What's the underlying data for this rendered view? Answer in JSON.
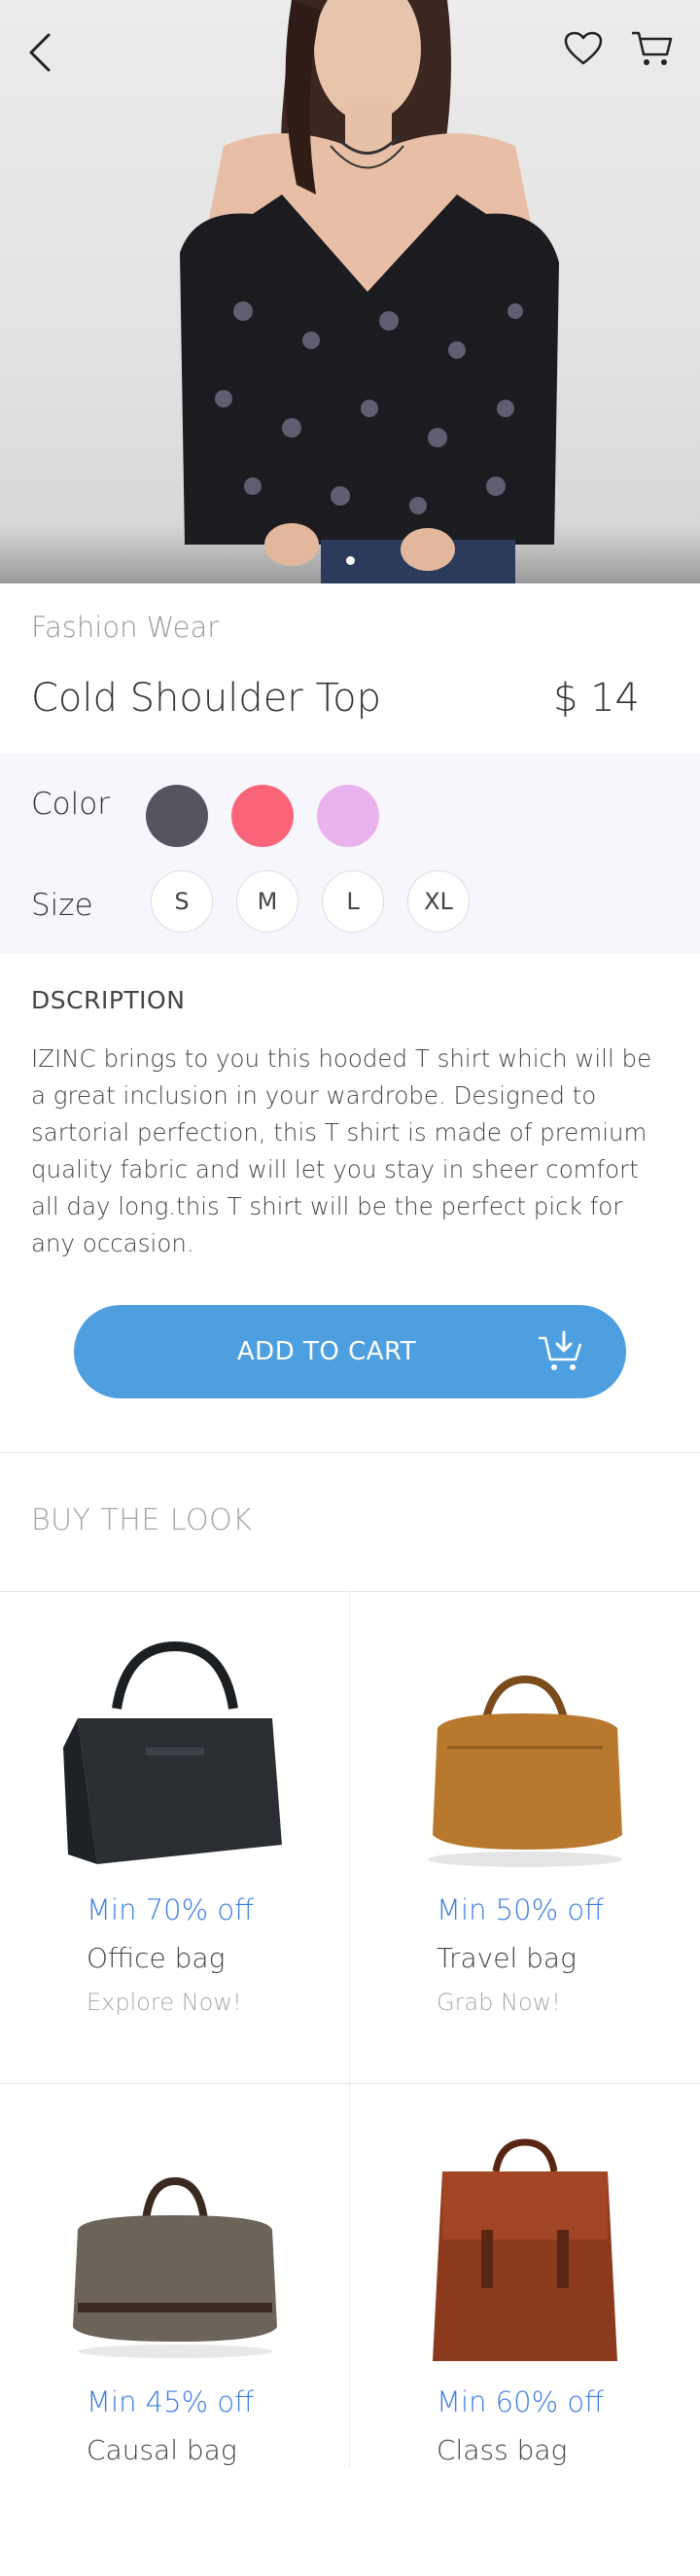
{
  "header": {
    "back_icon": "chevron-left-icon",
    "wishlist_icon": "heart-icon",
    "cart_icon": "cart-icon"
  },
  "gallery": {
    "current_slide": 1,
    "slide_count": 1
  },
  "product": {
    "category": "Fashion Wear",
    "name": "Cold Shoulder Top",
    "price": "$ 14"
  },
  "options": {
    "color_label": "Color",
    "colors": [
      "#555560",
      "#fa6479",
      "#eab3ee"
    ],
    "size_label": "Size",
    "sizes": [
      "S",
      "M",
      "L",
      "XL"
    ]
  },
  "description": {
    "heading": "DSCRIPTION",
    "body": "IZINC brings to you this hooded T shirt which will be a great inclusion in your wardrobe. Designed to sartorial perfection, this T shirt is made of premium quality fabric and will let you stay in sheer comfort all day long.this T shirt will be the perfect pick for any occasion."
  },
  "cart_button": {
    "label": "ADD TO CART",
    "icon": "cart-download-icon",
    "color": "#4d9fe0"
  },
  "buy_the_look": {
    "heading": "BUY THE LOOK",
    "items": [
      {
        "discount": "Min 70% off",
        "name": "Office bag",
        "cta": "Explore Now!"
      },
      {
        "discount": "Min 50% off",
        "name": "Travel bag",
        "cta": "Grab Now!"
      },
      {
        "discount": "Min 45% off",
        "name": "Causal bag",
        "cta": ""
      },
      {
        "discount": "Min 60% off",
        "name": "Class bag",
        "cta": ""
      }
    ]
  }
}
